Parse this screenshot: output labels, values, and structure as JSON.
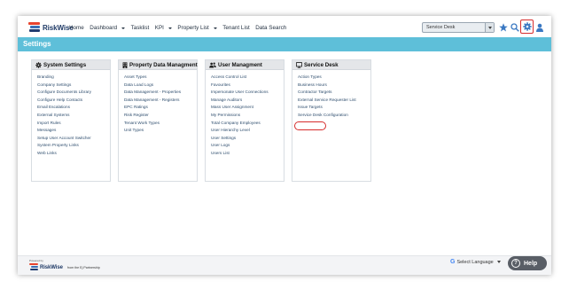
{
  "brand": {
    "name": "RiskWise"
  },
  "nav": {
    "items": [
      {
        "label": "Home",
        "dropdown": false
      },
      {
        "label": "Dashboard",
        "dropdown": true
      },
      {
        "label": "Tasklist",
        "dropdown": false
      },
      {
        "label": "KPI",
        "dropdown": true
      },
      {
        "label": "Property List",
        "dropdown": true
      },
      {
        "label": "Tenant List",
        "dropdown": false
      },
      {
        "label": "Data Search",
        "dropdown": false
      }
    ]
  },
  "header": {
    "module_select": "Service Desk",
    "icons": [
      "star-icon",
      "search-icon",
      "gear-icon",
      "user-icon"
    ]
  },
  "page": {
    "title": "Settings"
  },
  "panels": [
    {
      "title": "System Settings",
      "icon": "gear-icon",
      "items": [
        "Branding",
        "Company Settings",
        "Configure Documents Library",
        "Configure Help Contacts",
        "Email Escalations",
        "External Systems",
        "Import Rules",
        "Messages",
        "Setup User Account Switcher",
        "System Property Links",
        "Web Links"
      ]
    },
    {
      "title": "Property Data Managment",
      "icon": "building-icon",
      "items": [
        "Asset Types",
        "Data Load Logs",
        "Data Management - Properties",
        "Data Management - Registers",
        "EPC Ratings",
        "Risk Register",
        "Tenant Work Types",
        "Unit Types"
      ]
    },
    {
      "title": "User Managment",
      "icon": "users-icon",
      "items": [
        "Access Control List",
        "Favourites",
        "Impersonate User Connections",
        "Manage Auditors",
        "Mass User Assignment",
        "My Permissions",
        "Total Company Employees",
        "User Hierarchy Level",
        "User Settings",
        "User Logs",
        "Users List"
      ]
    },
    {
      "title": "Service Desk",
      "icon": "monitor-icon",
      "items": [
        "Action Types",
        "Business Hours",
        "Contractor Targets",
        "External Service Requester List",
        "Issue Targets",
        "Service Desk Configuration"
      ]
    }
  ],
  "footer": {
    "powered_by": "Powered by",
    "partnership": "from the Ej Partnership",
    "language_label": "Select Language",
    "help_label": "Help"
  },
  "colors": {
    "settings_bar": "#5ebfd9",
    "highlight": "#d62d2d",
    "link": "#2f4e6e",
    "brand": "#1f3a66"
  }
}
